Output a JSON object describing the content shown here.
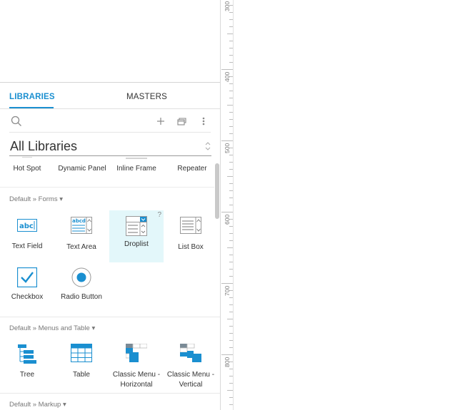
{
  "tabs": {
    "libraries": "LIBRARIES",
    "masters": "MASTERS"
  },
  "toolbar": {
    "search_icon": "search-icon",
    "add_icon": "plus-icon",
    "import_icon": "stack-icon",
    "more_icon": "vertical-ellipsis-icon"
  },
  "library_select": {
    "value": "All Libraries"
  },
  "partial_row": [
    "Hot Spot",
    "Dynamic Panel",
    "Inline Frame",
    "Repeater"
  ],
  "sections": {
    "forms": "Default » Forms ▾",
    "menus": "Default » Menus and Table ▾",
    "markup": "Default » Markup ▾"
  },
  "forms_widgets": {
    "text_field": "Text Field",
    "text_area": "Text Area",
    "droplist": "Droplist",
    "list_box": "List Box",
    "checkbox": "Checkbox",
    "radio_button": "Radio Button",
    "help": "?"
  },
  "menu_widgets": {
    "tree": "Tree",
    "table": "Table",
    "classic_h_1": "Classic Menu -",
    "classic_h_2": "Horizontal",
    "classic_v_1": "Classic Menu -",
    "classic_v_2": "Vertical"
  },
  "ruler": [
    "300",
    "400",
    "500",
    "600",
    "700",
    "800"
  ],
  "colors": {
    "accent": "#1a8fd0",
    "selected_bg": "#e3f7fa"
  }
}
